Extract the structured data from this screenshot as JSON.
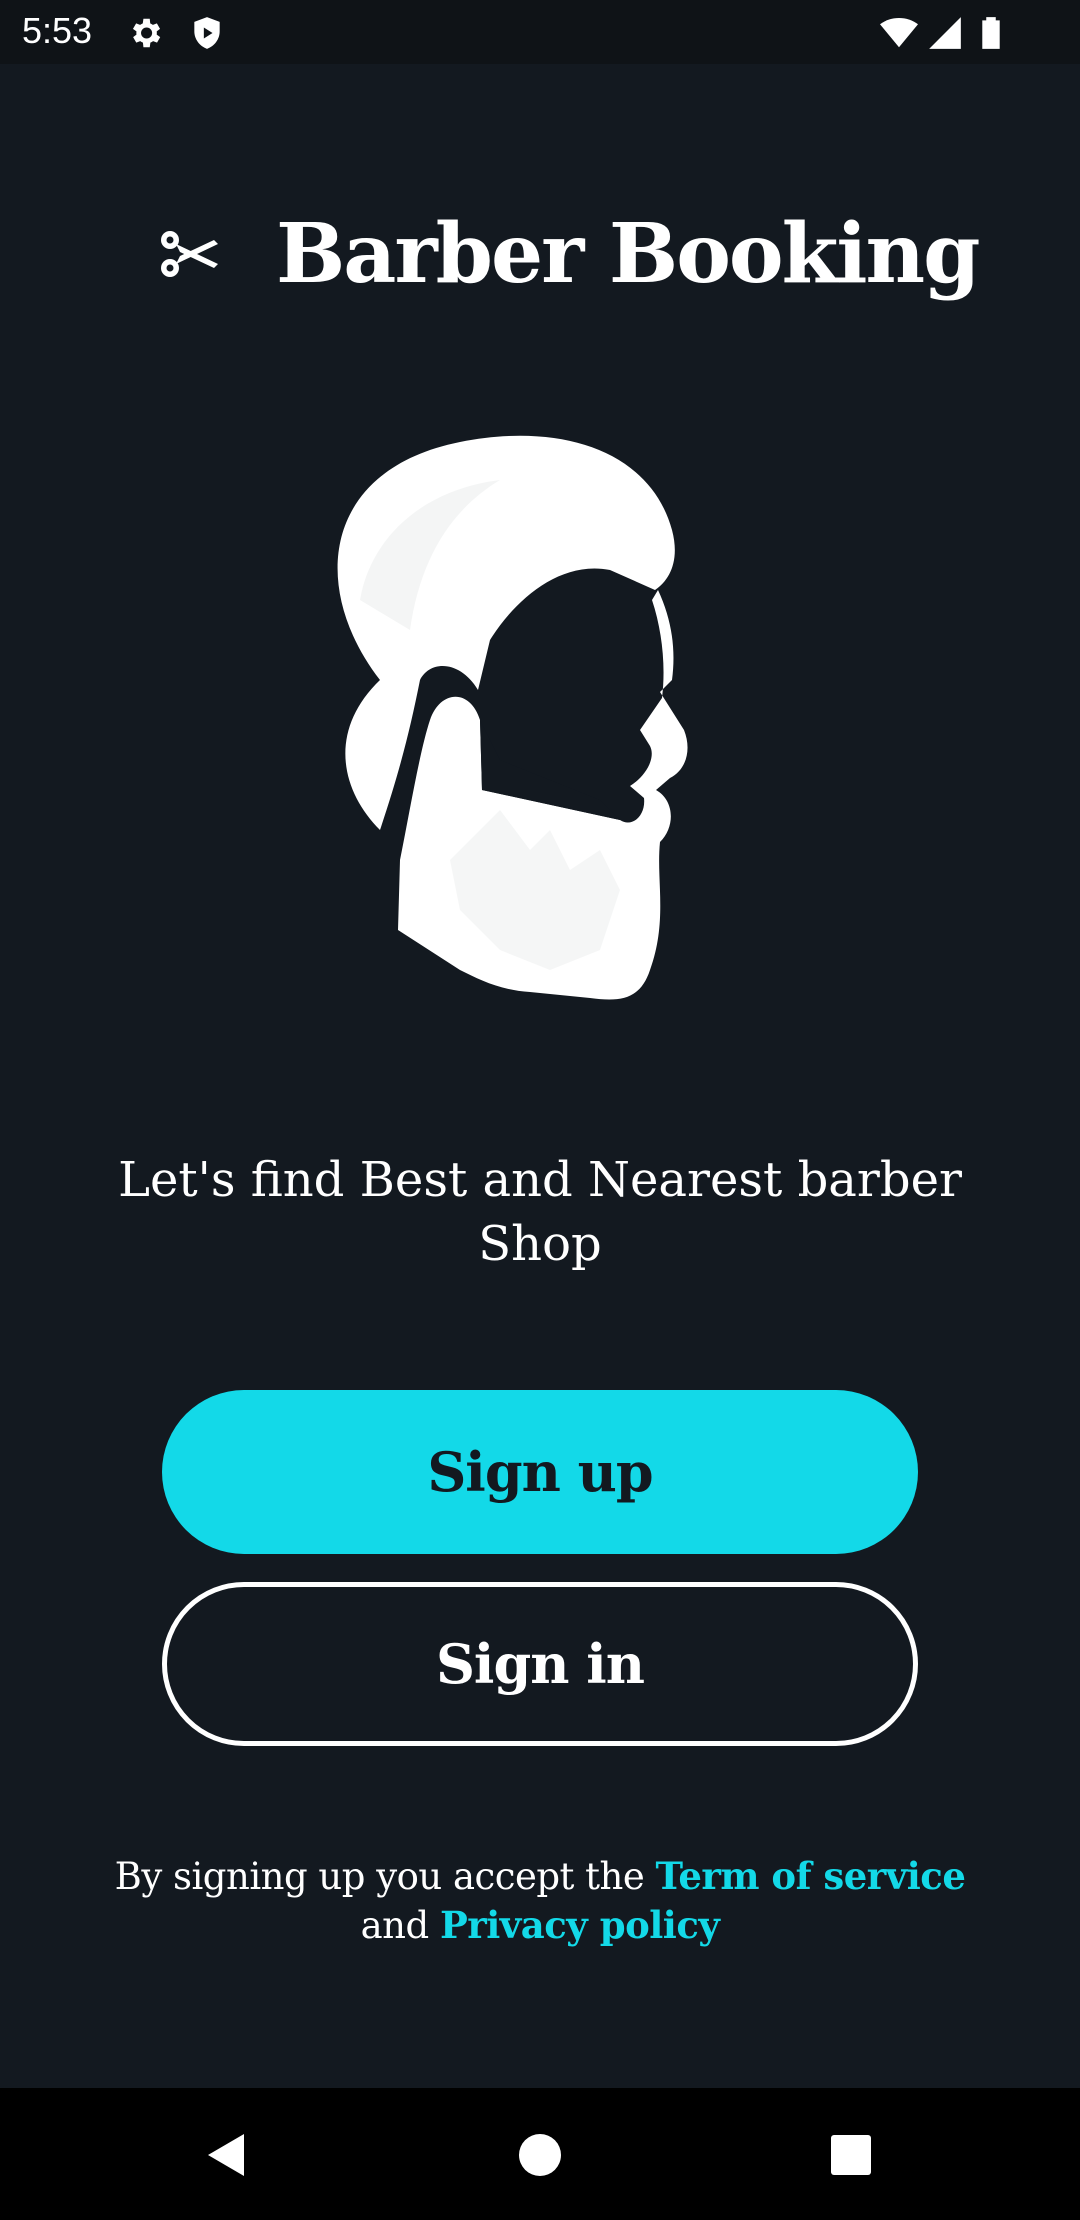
{
  "status_bar": {
    "time": "5:53",
    "icons": [
      "gear-icon",
      "shield-icon",
      "wifi-icon",
      "cell-signal-icon",
      "battery-icon"
    ]
  },
  "app": {
    "title": "Barber Booking",
    "logo_icon": "scissors-icon",
    "hero_icon": "bearded-man-profile-icon"
  },
  "tagline": "Let's find Best and Nearest barber Shop",
  "buttons": {
    "signup_label": "Sign up",
    "signin_label": "Sign in"
  },
  "terms": {
    "prefix": "By signing up you accept the",
    "terms_link": "Term of service",
    "conjunction": "and",
    "privacy_link": "Privacy policy"
  },
  "navigation_bar": {
    "icons": [
      "back-icon",
      "home-icon",
      "recents-icon"
    ]
  },
  "colors": {
    "background": "#131920",
    "accent": "#13d9e8",
    "text": "#ffffff"
  }
}
